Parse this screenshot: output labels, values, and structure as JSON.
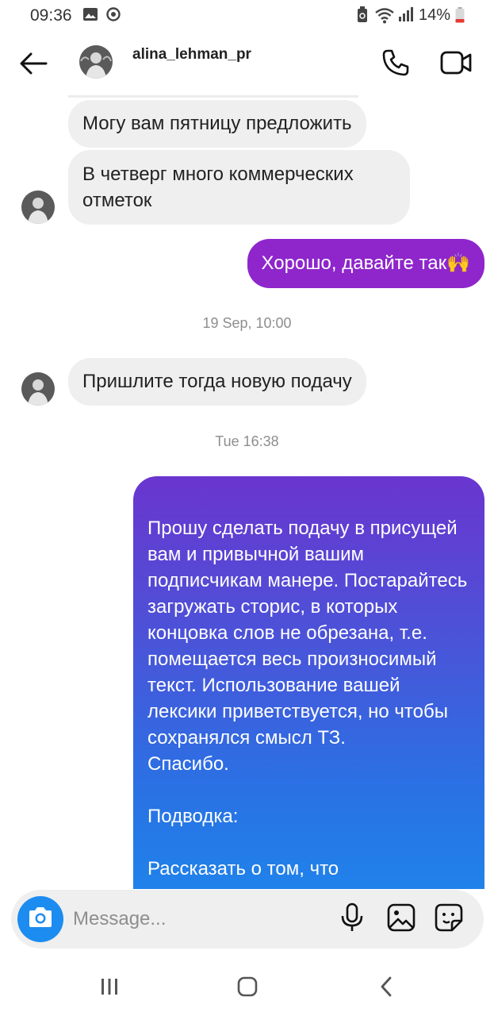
{
  "status_bar": {
    "time": "09:36",
    "battery": "14%",
    "icons": [
      "gallery-icon",
      "sync-icon",
      "recycle-icon",
      "wifi-icon",
      "signal-icon",
      "battery-icon"
    ]
  },
  "header": {
    "username": "alina_lehman_pr",
    "back_icon": "back-arrow-icon",
    "call_icon": "phone-icon",
    "video_icon": "video-icon"
  },
  "messages": [
    {
      "direction": "in",
      "text": "Могу вам пятницу предложить"
    },
    {
      "direction": "in",
      "text": "В четверг много коммерческих отметок"
    },
    {
      "direction": "out",
      "text": "Хорошо, давайте так🙌"
    },
    {
      "type": "timestamp",
      "text": "19 Sep, 10:00"
    },
    {
      "direction": "in",
      "text": "Пришлите тогда новую подачу"
    },
    {
      "type": "timestamp",
      "text": "Tue 16:38"
    },
    {
      "direction": "out",
      "text": "Прошу сделать подачу в присущей вам и привычной вашим подписчикам манере. Постарайтесь загружать сторис, в которых концовка слов не обрезана, т.е. помещается весь произносимый текст. Использование вашей лексики приветствуется, но чтобы сохранялся смысл ТЗ.\nСпасибо.\n\nПодводка:\n\nРассказать о том, что"
    }
  ],
  "composer": {
    "placeholder": "Message...",
    "value": "",
    "icons": [
      "camera-icon",
      "microphone-icon",
      "image-icon",
      "sticker-icon"
    ]
  },
  "nav": {
    "icons": [
      "recent-apps-icon",
      "home-icon",
      "back-icon"
    ]
  },
  "colors": {
    "accent_blue": "#1c8cf0",
    "outgoing_purple": "#8e26cc",
    "incoming_gray": "#efefef"
  }
}
